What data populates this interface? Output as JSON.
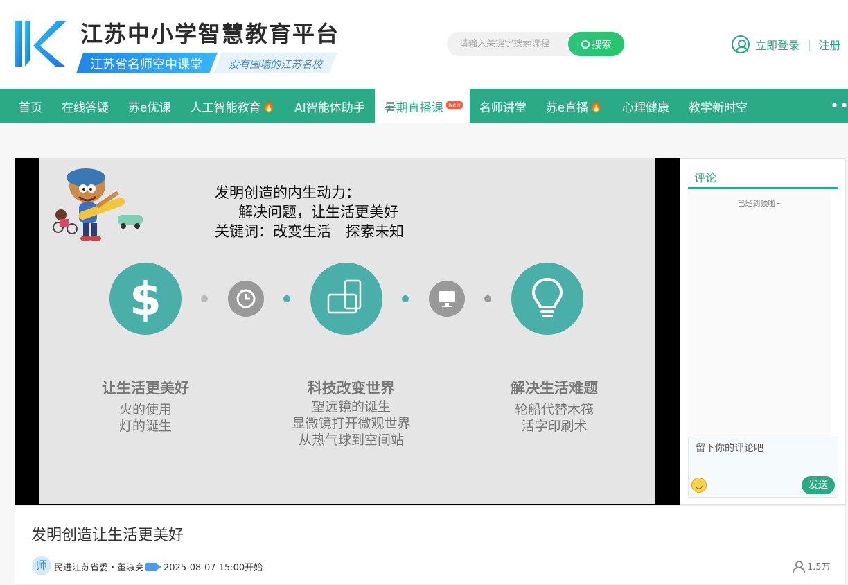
{
  "header": {
    "site_title": "江苏中小学智慧教育平台",
    "banner_main": "江苏省名师空中课堂",
    "banner_slogan": "没有围墙的江苏名校",
    "search_placeholder": "请输入关键字搜索课程",
    "search_button": "搜索",
    "login": "立即登录",
    "separator": "|",
    "register": "注册"
  },
  "nav": {
    "items": [
      {
        "label": "首页"
      },
      {
        "label": "在线答疑"
      },
      {
        "label": "苏e优课"
      },
      {
        "label": "人工智能教育",
        "hot": true
      },
      {
        "label": "AI智能体助手"
      },
      {
        "label": "暑期直播课",
        "badge": "New",
        "active": true
      },
      {
        "label": "名师讲堂"
      },
      {
        "label": "苏e直播",
        "hot": true
      },
      {
        "label": "心理健康"
      },
      {
        "label": "教学新时空"
      }
    ],
    "more": "•••"
  },
  "slide": {
    "heading_line1": "发明创造的内生动力：",
    "heading_line2": "解决问题，让生活更美好",
    "heading_line3": "关键词：改变生活　探索未知",
    "columns": [
      {
        "title": "让生活更美好",
        "lines": [
          "火的使用",
          "灯的诞生"
        ]
      },
      {
        "title": "科技改变世界",
        "lines": [
          "望远镜的诞生",
          "显微镜打开微观世界",
          "从热气球到空间站"
        ]
      },
      {
        "title": "解决生活难题",
        "lines": [
          "轮船代替木筏",
          "活字印刷术"
        ]
      }
    ],
    "accent_color": "#4aafa9"
  },
  "comments": {
    "tab": "评论",
    "top_notice": "已经到顶啦~",
    "input_placeholder": "留下你的评论吧",
    "emoji_icon": "smiley-icon",
    "send": "发送"
  },
  "lesson": {
    "title": "发明创造让生活更美好",
    "avatar_char": "师",
    "teacher": "民进江苏省委・董淑亮",
    "start_time": "2025-08-07 15:00开始",
    "views": "1.5万"
  },
  "colors": {
    "brand_green": "#2bab85",
    "banner_blue": "#1f86e8"
  }
}
